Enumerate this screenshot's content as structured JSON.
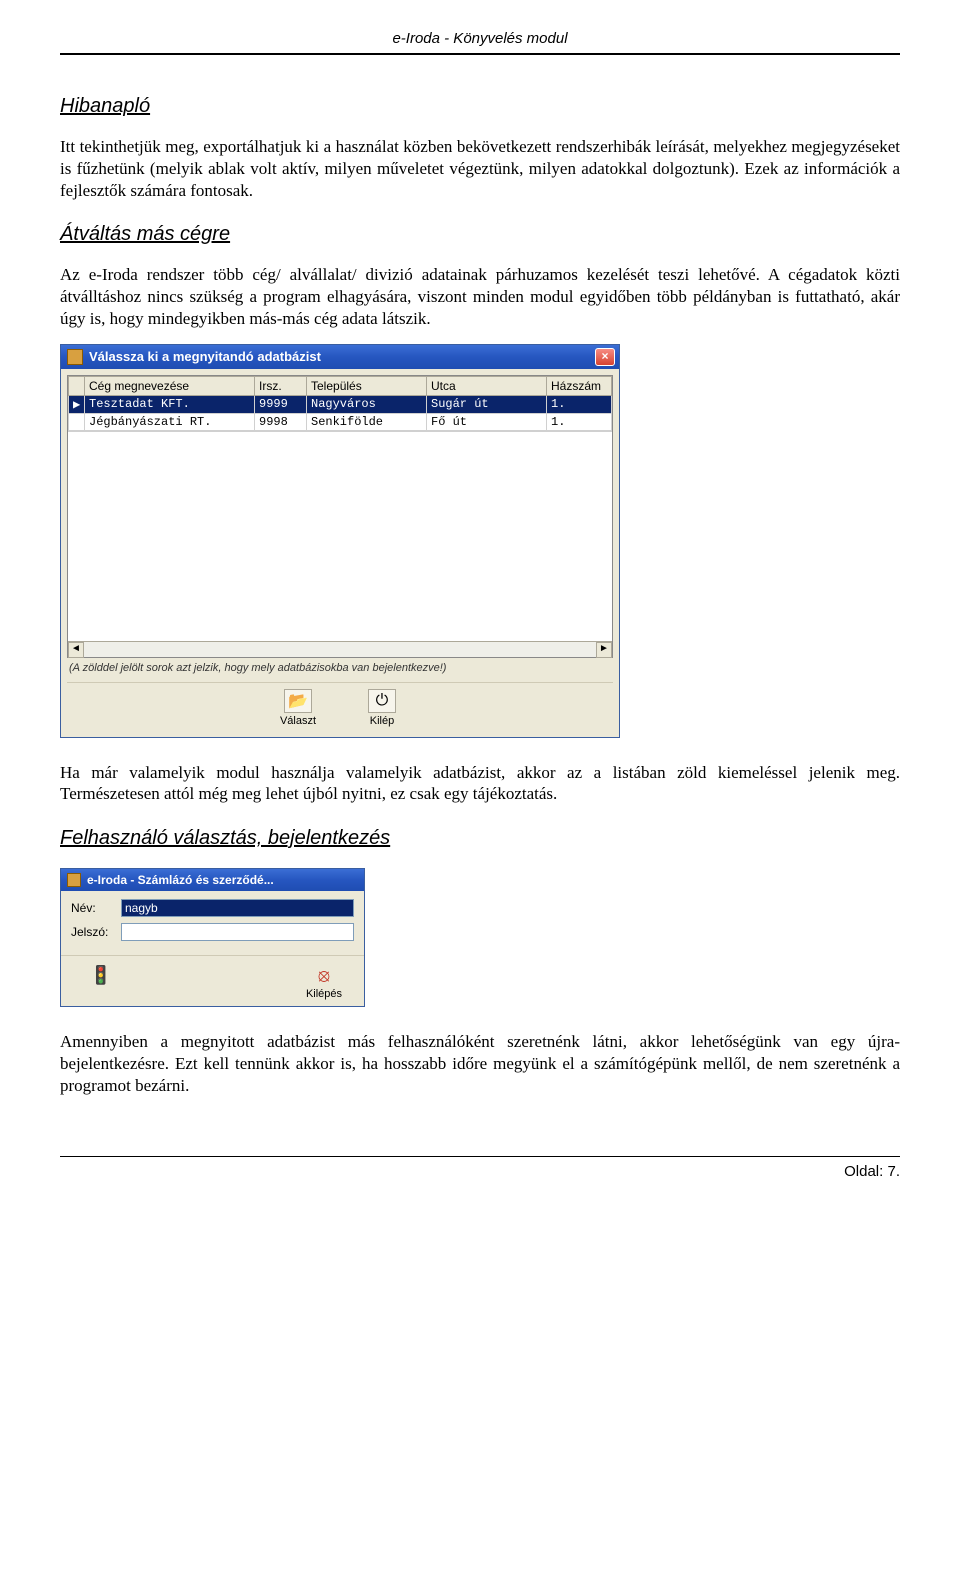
{
  "header": {
    "title": "e-Iroda - Könyvelés modul"
  },
  "sections": {
    "s1": {
      "heading": "Hibanapló",
      "para1": "Itt tekinthetjük meg, exportálhatjuk ki a használat közben bekövetkezett rendszerhibák leírását, melyekhez megjegyzéseket is fűzhetünk (melyik ablak volt aktív, milyen műveletet végeztünk, milyen adatokkal dolgoztunk). Ezek az információk a fejlesztők számára fontosak."
    },
    "s2": {
      "heading": "Átváltás más cégre",
      "para1": "Az e-Iroda rendszer több cég/ alvállalat/ divizió adatainak párhuzamos kezelését teszi lehetővé. A cégadatok közti átválltáshoz nincs szükség a program elhagyására, viszont minden modul egyidőben több példányban is futtatható, akár úgy is, hogy mindegyikben más-más cég adata látszik.",
      "para2": "Ha már valamelyik modul használja valamelyik adatbázist, akkor az a listában zöld kiemeléssel jelenik meg. Természetesen attól még meg lehet újból nyitni, ez csak egy tájékoztatás."
    },
    "s3": {
      "heading": "Felhasználó választás, bejelentkezés",
      "para1": "Amennyiben a megnyitott adatbázist más felhasználóként szeretnénk látni, akkor lehetőségünk van egy újra-bejelentkezésre. Ezt kell tennünk akkor is, ha hosszabb időre megyünk el a számítógépünk mellől, de nem szeretnénk a programot bezárni."
    }
  },
  "db_dialog": {
    "title": "Válassza ki a megnyitandó adatbázist",
    "columns": [
      "",
      "Cég megnevezése",
      "Irsz.",
      "Település",
      "Utca",
      "Házszám"
    ],
    "rows": [
      {
        "marker": "▶",
        "name": "Tesztadat KFT.",
        "zip": "9999",
        "city": "Nagyváros",
        "street": "Sugár út",
        "num": "1."
      },
      {
        "marker": "",
        "name": "Jégbányászati RT.",
        "zip": "9998",
        "city": "Senkifölde",
        "street": "Fő út",
        "num": "1."
      }
    ],
    "note": "(A zölddel jelölt sorok azt jelzik, hogy mely adatbázisokba van bejelentkezve!)",
    "btn_select": "Választ",
    "btn_exit": "Kilép"
  },
  "login_dialog": {
    "title": "e-Iroda - Számlázó és szerződé...",
    "name_label": "Név:",
    "name_value": "nagyb",
    "pass_label": "Jelszó:",
    "pass_value": "",
    "btn_exit": "Kilépés"
  },
  "footer": {
    "page": "Oldal: 7."
  }
}
